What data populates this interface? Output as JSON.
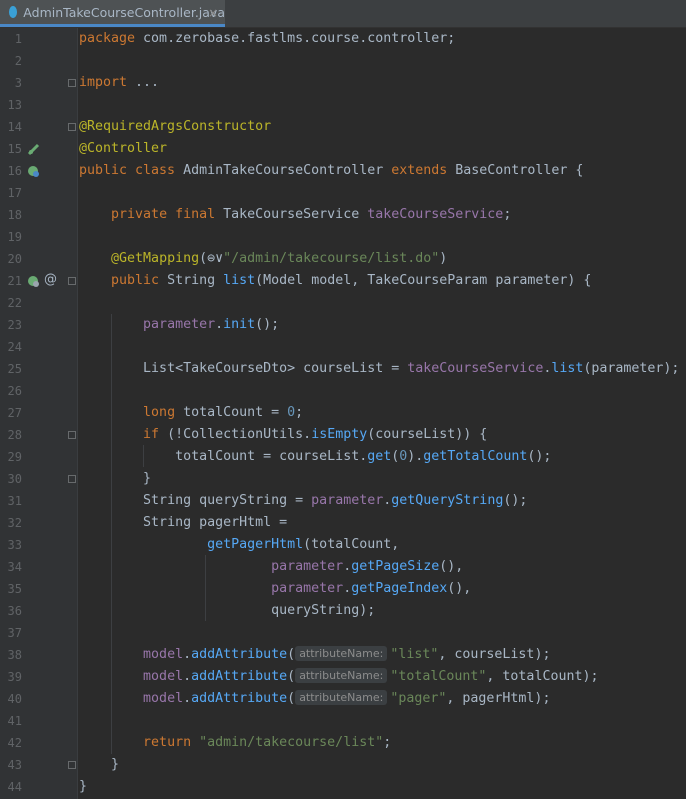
{
  "tab": {
    "filename": "AdminTakeCourseController.java",
    "close": "×"
  },
  "lines": [
    {
      "n": "1",
      "segs": [
        [
          "kw",
          "package "
        ],
        [
          "",
          "com.zerobase.fastlms.course.controller;"
        ]
      ]
    },
    {
      "n": "2",
      "segs": []
    },
    {
      "n": "3",
      "segs": [
        [
          "kw",
          "import "
        ],
        [
          "",
          "..."
        ]
      ]
    },
    {
      "n": "13",
      "segs": []
    },
    {
      "n": "14",
      "segs": [
        [
          "ann",
          "@RequiredArgsConstructor"
        ]
      ]
    },
    {
      "n": "15",
      "segs": [
        [
          "ann",
          "@Controller"
        ]
      ]
    },
    {
      "n": "16",
      "segs": [
        [
          "kw",
          "public class "
        ],
        [
          "",
          "AdminTakeCourseController "
        ],
        [
          "kw",
          "extends "
        ],
        [
          "",
          "BaseController {"
        ]
      ]
    },
    {
      "n": "17",
      "segs": []
    },
    {
      "n": "18",
      "segs": [
        [
          "",
          "    "
        ],
        [
          "kw",
          "private final "
        ],
        [
          "",
          "TakeCourseService "
        ],
        [
          "fld",
          "takeCourseService"
        ],
        [
          "",
          "; "
        ]
      ]
    },
    {
      "n": "19",
      "segs": []
    },
    {
      "n": "20",
      "segs": [
        [
          "",
          "    "
        ],
        [
          "ann",
          "@GetMapping"
        ],
        [
          "",
          "(⊜∨"
        ],
        [
          "str",
          "\"/admin/takecourse/list.do\""
        ],
        [
          "",
          ")"
        ]
      ]
    },
    {
      "n": "21",
      "segs": [
        [
          "",
          "    "
        ],
        [
          "kw",
          "public "
        ],
        [
          "",
          "String "
        ],
        [
          "mth",
          "list"
        ],
        [
          "",
          "(Model model, TakeCourseParam parameter) {"
        ]
      ]
    },
    {
      "n": "22",
      "segs": []
    },
    {
      "n": "23",
      "segs": [
        [
          "",
          "        "
        ],
        [
          "fld",
          "parameter"
        ],
        [
          "",
          "."
        ],
        [
          "mth",
          "init"
        ],
        [
          "",
          "();"
        ]
      ]
    },
    {
      "n": "24",
      "segs": []
    },
    {
      "n": "25",
      "segs": [
        [
          "",
          "        "
        ],
        [
          "",
          "List<TakeCourseDto> courseList = "
        ],
        [
          "fld",
          "takeCourseService"
        ],
        [
          "",
          "."
        ],
        [
          "mth",
          "list"
        ],
        [
          "",
          "(parameter);"
        ]
      ]
    },
    {
      "n": "26",
      "segs": []
    },
    {
      "n": "27",
      "segs": [
        [
          "",
          "        "
        ],
        [
          "kw",
          "long "
        ],
        [
          "",
          "totalCount = "
        ],
        [
          "num",
          "0"
        ],
        [
          "",
          ";"
        ]
      ]
    },
    {
      "n": "28",
      "segs": [
        [
          "",
          "        "
        ],
        [
          "kw",
          "if "
        ],
        [
          "",
          "(!CollectionUtils."
        ],
        [
          "mth",
          "isEmpty"
        ],
        [
          "",
          "(courseList)) {"
        ]
      ]
    },
    {
      "n": "29",
      "segs": [
        [
          "",
          "            "
        ],
        [
          "",
          "totalCount = courseList."
        ],
        [
          "mth",
          "get"
        ],
        [
          "",
          "("
        ],
        [
          "num",
          "0"
        ],
        [
          "",
          ")."
        ],
        [
          "mth",
          "getTotalCount"
        ],
        [
          "",
          "();"
        ]
      ]
    },
    {
      "n": "30",
      "segs": [
        [
          "",
          "        "
        ],
        [
          "",
          "}"
        ]
      ]
    },
    {
      "n": "31",
      "segs": [
        [
          "",
          "        "
        ],
        [
          "",
          "String queryString = "
        ],
        [
          "fld",
          "parameter"
        ],
        [
          "",
          "."
        ],
        [
          "mth",
          "getQueryString"
        ],
        [
          "",
          "();"
        ]
      ]
    },
    {
      "n": "32",
      "segs": [
        [
          "",
          "        "
        ],
        [
          "",
          "String pagerHtml ="
        ]
      ]
    },
    {
      "n": "33",
      "segs": [
        [
          "",
          "                "
        ],
        [
          "mth",
          "getPagerHtml"
        ],
        [
          "",
          "(totalCount,"
        ]
      ]
    },
    {
      "n": "34",
      "segs": [
        [
          "",
          "                        "
        ],
        [
          "fld",
          "parameter"
        ],
        [
          "",
          "."
        ],
        [
          "mth",
          "getPageSize"
        ],
        [
          "",
          "(),"
        ]
      ]
    },
    {
      "n": "35",
      "segs": [
        [
          "",
          "                        "
        ],
        [
          "fld",
          "parameter"
        ],
        [
          "",
          "."
        ],
        [
          "mth",
          "getPageIndex"
        ],
        [
          "",
          "(),"
        ]
      ]
    },
    {
      "n": "36",
      "segs": [
        [
          "",
          "                        "
        ],
        [
          "",
          "queryString);"
        ]
      ]
    },
    {
      "n": "37",
      "segs": []
    },
    {
      "n": "38",
      "segs": [
        [
          "",
          "        "
        ],
        [
          "fld",
          "model"
        ],
        [
          "",
          "."
        ],
        [
          "mth",
          "addAttribute"
        ],
        [
          "",
          "("
        ],
        [
          "hint",
          "attributeName:"
        ],
        [
          "str",
          "\"list\""
        ],
        [
          "",
          ", courseList);"
        ]
      ]
    },
    {
      "n": "39",
      "segs": [
        [
          "",
          "        "
        ],
        [
          "fld",
          "model"
        ],
        [
          "",
          "."
        ],
        [
          "mth",
          "addAttribute"
        ],
        [
          "",
          "("
        ],
        [
          "hint",
          "attributeName:"
        ],
        [
          "str",
          "\"totalCount\""
        ],
        [
          "",
          ", totalCount);"
        ]
      ]
    },
    {
      "n": "40",
      "segs": [
        [
          "",
          "        "
        ],
        [
          "fld",
          "model"
        ],
        [
          "",
          "."
        ],
        [
          "mth",
          "addAttribute"
        ],
        [
          "",
          "("
        ],
        [
          "hint",
          "attributeName:"
        ],
        [
          "str",
          "\"pager\""
        ],
        [
          "",
          ", pagerHtml);"
        ]
      ]
    },
    {
      "n": "41",
      "segs": []
    },
    {
      "n": "42",
      "segs": [
        [
          "",
          "        "
        ],
        [
          "kw",
          "return "
        ],
        [
          "str",
          "\"admin/takecourse/list\""
        ],
        [
          "",
          ";"
        ]
      ]
    },
    {
      "n": "43",
      "segs": [
        [
          "",
          "    "
        ],
        [
          "",
          "}"
        ]
      ]
    },
    {
      "n": "44",
      "segs": [
        [
          "",
          "}"
        ]
      ]
    }
  ],
  "colors": {
    "background": "#2b2b2b",
    "keyword": "#cc7832",
    "annotation": "#bbb529",
    "string": "#6a8759",
    "field": "#9876aa",
    "method": "#56a8f5",
    "number": "#6897bb"
  },
  "gutter_icons": [
    {
      "line": "15",
      "name": "spring-bean-icon"
    },
    {
      "line": "16",
      "name": "spring-bean-icon"
    },
    {
      "line": "21",
      "name": "spring-web-icon"
    },
    {
      "line": "21",
      "name": "at-symbol-icon",
      "text": "@"
    }
  ]
}
